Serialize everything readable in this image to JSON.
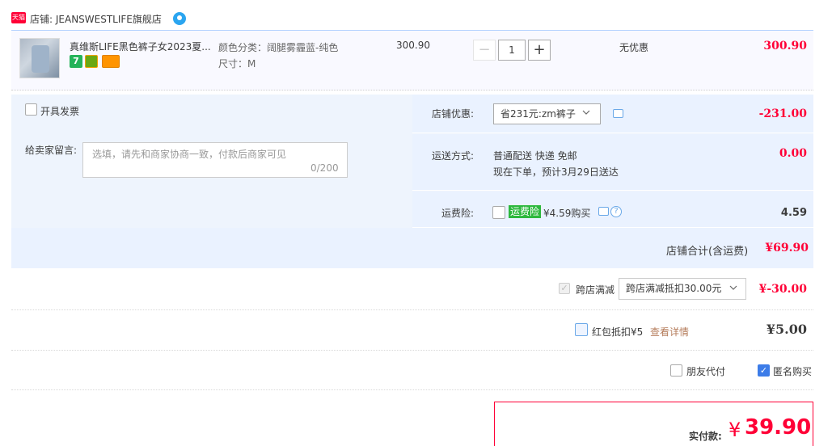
{
  "shop": {
    "badge": "天猫",
    "label": "店铺: JEANSWESTLIFE旗舰店"
  },
  "item": {
    "title": "真维斯LIFE黑色裤子女2023夏...",
    "service_icons": [
      "seven-day-return-icon",
      "quality-guarantee-icon",
      "card-payment-icon"
    ],
    "service_seven": "7",
    "sku_color": "颜色分类：阔腿雾霾蓝-纯色",
    "sku_size": "尺寸：M",
    "unit_price": "300.90",
    "quantity": "1",
    "minus": "−",
    "plus": "+",
    "promo": "无优惠",
    "total": "300.90"
  },
  "order": {
    "invoice_label": "开具发票",
    "message_label": "给卖家留言:",
    "message_placeholder": "选填，请先和商家协商一致，付款后商家可见",
    "message_count": "0/200",
    "coupon_label": "店铺优惠:",
    "coupon_selected": "省231元:zm裤子",
    "coupon_value": "-231.00",
    "shipping_label": "运送方式:",
    "shipping_line1": "普通配送 快递 免邮",
    "shipping_line2": "现在下单，预计3月29日送达",
    "shipping_value": "0.00",
    "insurance_label": "运费险:",
    "insurance_badge": "运费险",
    "insurance_price": "¥4.59购买",
    "insurance_help": "?",
    "insurance_value": "4.59",
    "shop_total_label": "店铺合计(含运费)",
    "shop_total_value": "¥69.90"
  },
  "discounts": {
    "cross_label": "跨店满减",
    "cross_check": "✓",
    "cross_selected": "跨店满减抵扣30.00元",
    "cross_value": "¥-30.00",
    "redpack_label": "红包抵扣¥5",
    "redpack_link": "查看详情",
    "redpack_value": "¥5.00",
    "friend_pay_label": "朋友代付",
    "anonymous_label": "匿名购买",
    "anonymous_check": "✓"
  },
  "payment": {
    "label": "实付款:",
    "currency": "¥",
    "amount": "39.90"
  },
  "colors": {
    "accent_red": "#ff0036",
    "panel_blue": "#eef4fd",
    "link_brown": "#b57c5b",
    "check_blue": "#3c7ce8"
  }
}
